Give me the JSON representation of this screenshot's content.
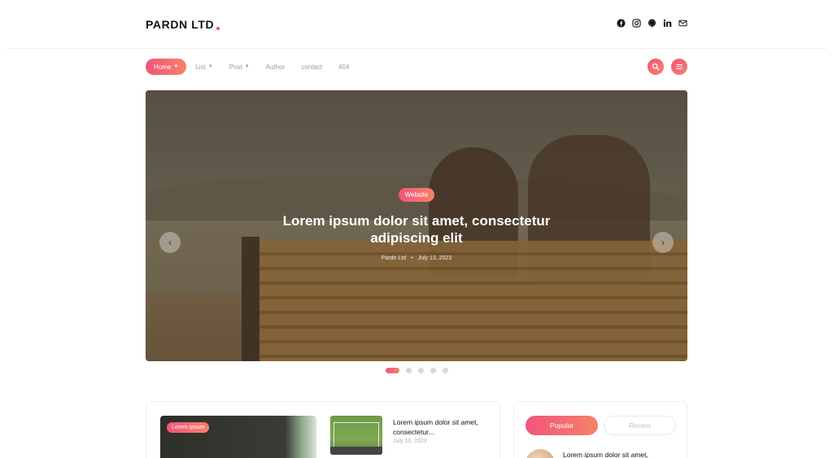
{
  "header": {
    "logo": "PARDN LTD",
    "social_icons": [
      "facebook-icon",
      "instagram-icon",
      "github-icon",
      "linkedin-icon",
      "mail-icon"
    ]
  },
  "nav": {
    "items": [
      {
        "label": "Home",
        "active": true,
        "dropdown": true
      },
      {
        "label": "List",
        "active": false,
        "dropdown": true
      },
      {
        "label": "Post",
        "active": false,
        "dropdown": true
      },
      {
        "label": "Author",
        "active": false,
        "dropdown": false
      },
      {
        "label": "contact",
        "active": false,
        "dropdown": false
      },
      {
        "label": "404",
        "active": false,
        "dropdown": false
      }
    ],
    "right_icons": [
      "search-icon",
      "menu-icon"
    ]
  },
  "hero": {
    "badge": "Website",
    "title_line1": "Lorem ipsum dolor sit amet, consectetur",
    "title_line2": "adipiscing elit",
    "author": "Pardn Ltd",
    "date": "July 13, 2023",
    "slides_count": 5,
    "active_slide": 1
  },
  "featured": {
    "badge": "Lorem ipsum",
    "post_title": "Lorem ipsum dolor sit amet, consectetur...",
    "post_date": "July 13, 2023"
  },
  "sidebar": {
    "tabs": [
      "Popular",
      "Recent"
    ],
    "active_tab": "Popular",
    "first_item_title": "Lorem ipsum dolor sit amet,"
  },
  "colors": {
    "accent_start": "#f1557a",
    "accent_end": "#f7816a"
  }
}
